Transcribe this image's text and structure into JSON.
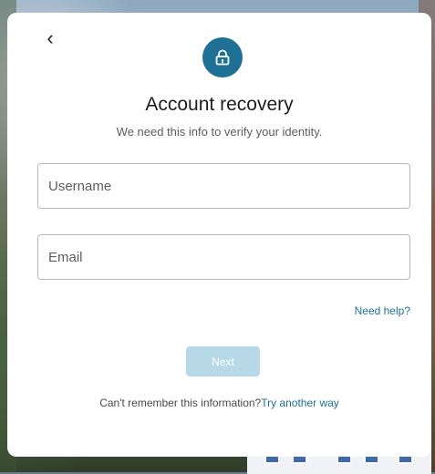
{
  "dialog": {
    "back_label": "‹",
    "title": "Account recovery",
    "subtitle": "We need this info to verify your identity.",
    "username_placeholder": "Username",
    "email_placeholder": "Email",
    "help_link": "Need help?",
    "next_label": "Next",
    "recovery_text": "Can't remember this information?",
    "recovery_link": "Try another way"
  },
  "colors": {
    "accent": "#1e7094",
    "link": "#1f6f95",
    "disabled_button": "#b7d8e7"
  },
  "icons": {
    "back": "chevron-left-icon",
    "lock": "lock-icon"
  }
}
